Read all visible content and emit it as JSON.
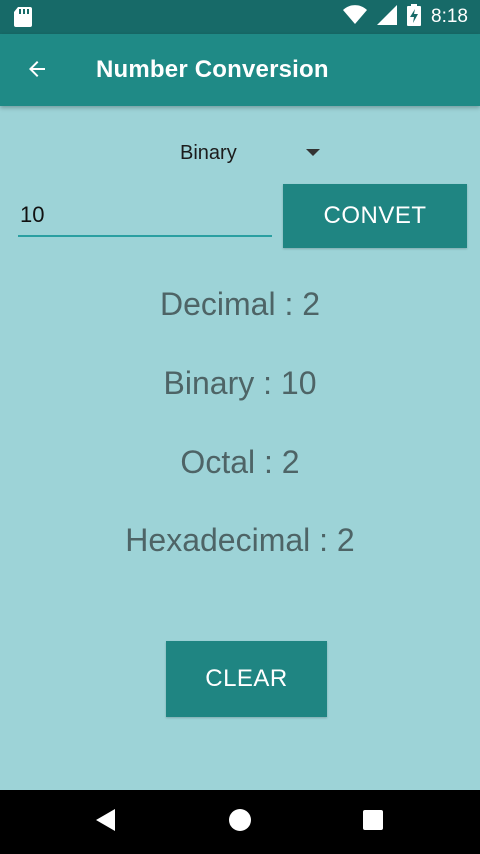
{
  "status_bar": {
    "time": "8:18",
    "icons": [
      "sd-card-icon",
      "wifi-icon",
      "signal-icon",
      "battery-charging-icon"
    ]
  },
  "app_bar": {
    "title": "Number Conversion",
    "back_icon": "arrow-back-icon"
  },
  "base_selector": {
    "selected": "Binary"
  },
  "input": {
    "value": "10"
  },
  "convert_button": {
    "label": "CONVET"
  },
  "results": {
    "decimal": "Decimal : 2",
    "binary": "Binary : 10",
    "octal": "Octal : 2",
    "hexadecimal": "Hexadecimal : 2"
  },
  "clear_button": {
    "label": "CLEAR"
  },
  "nav_bar": {
    "icons": [
      "back-triangle-icon",
      "home-circle-icon",
      "recents-square-icon"
    ]
  },
  "colors": {
    "status_bar": "#176a68",
    "app_bar": "#1f8a86",
    "background": "#9dd3d7",
    "button": "#1f8582",
    "result_text": "#4e6466"
  }
}
